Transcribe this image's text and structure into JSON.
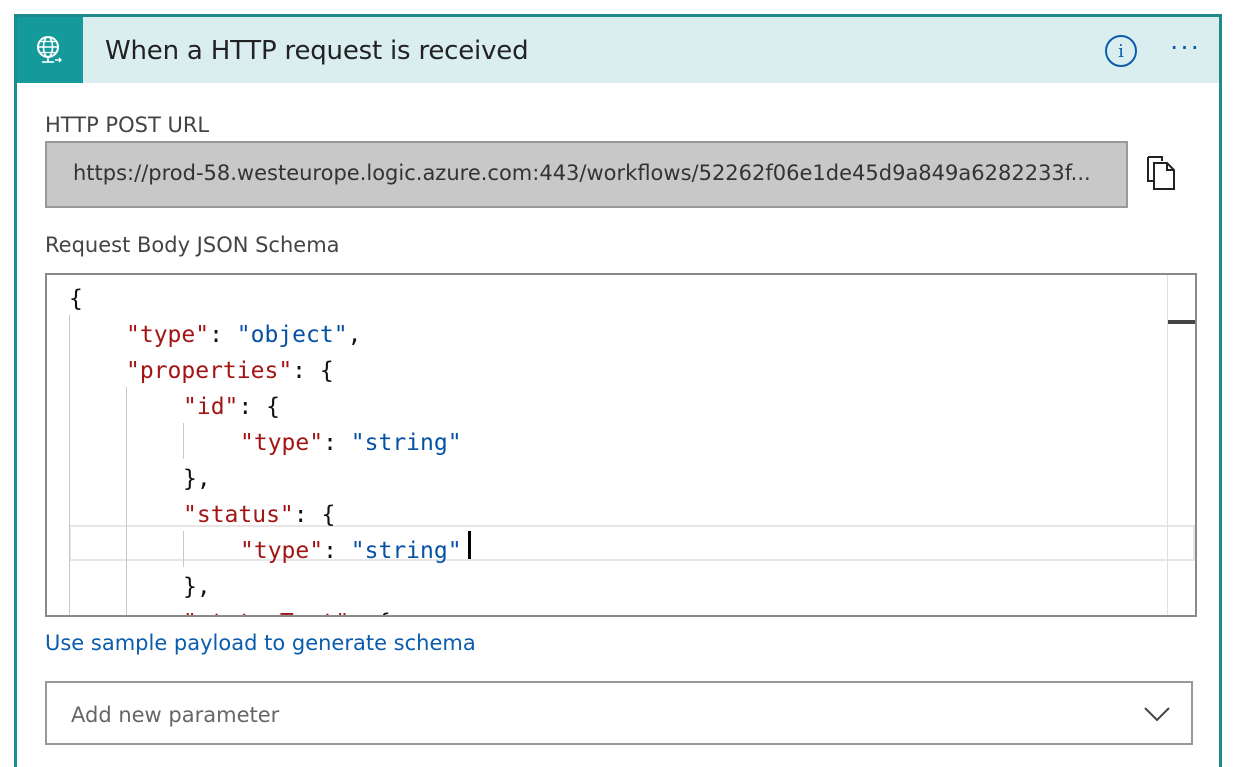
{
  "header": {
    "title": "When a HTTP request is received",
    "icon": "globe-request-icon",
    "info_glyph": "i",
    "more_glyph": "···"
  },
  "url_section": {
    "label": "HTTP POST URL",
    "value": "https://prod-58.westeurope.logic.azure.com:443/workflows/52262f06e1de45d9a849a6282233f...",
    "copy_icon": "copy-icon"
  },
  "schema_section": {
    "label": "Request Body JSON Schema",
    "lines": [
      {
        "indent": 0,
        "tokens": [
          {
            "t": "p",
            "v": "{"
          }
        ]
      },
      {
        "indent": 1,
        "tokens": [
          {
            "t": "k",
            "v": "\"type\""
          },
          {
            "t": "p",
            "v": ": "
          },
          {
            "t": "s",
            "v": "\"object\""
          },
          {
            "t": "p",
            "v": ","
          }
        ]
      },
      {
        "indent": 1,
        "tokens": [
          {
            "t": "k",
            "v": "\"properties\""
          },
          {
            "t": "p",
            "v": ": {"
          }
        ]
      },
      {
        "indent": 2,
        "tokens": [
          {
            "t": "k",
            "v": "\"id\""
          },
          {
            "t": "p",
            "v": ": {"
          }
        ]
      },
      {
        "indent": 3,
        "tokens": [
          {
            "t": "k",
            "v": "\"type\""
          },
          {
            "t": "p",
            "v": ": "
          },
          {
            "t": "s",
            "v": "\"string\""
          }
        ]
      },
      {
        "indent": 2,
        "tokens": [
          {
            "t": "p",
            "v": "},"
          }
        ]
      },
      {
        "indent": 2,
        "tokens": [
          {
            "t": "k",
            "v": "\"status\""
          },
          {
            "t": "p",
            "v": ": {"
          }
        ]
      },
      {
        "indent": 3,
        "tokens": [
          {
            "t": "k",
            "v": "\"type\""
          },
          {
            "t": "p",
            "v": ": "
          },
          {
            "t": "s",
            "v": "\"string\""
          }
        ]
      },
      {
        "indent": 2,
        "tokens": [
          {
            "t": "p",
            "v": "},"
          }
        ]
      },
      {
        "indent": 2,
        "tokens": [
          {
            "t": "k",
            "v": "\"statusText\""
          },
          {
            "t": "p",
            "v": ": {"
          }
        ]
      }
    ]
  },
  "sample_link": "Use sample payload to generate schema",
  "add_parameter": {
    "placeholder": "Add new parameter"
  },
  "colors": {
    "accent": "#159a9c",
    "header_bg": "#daeef0",
    "link": "#0b5cad",
    "json_key": "#a31515",
    "json_string": "#0451a5"
  }
}
